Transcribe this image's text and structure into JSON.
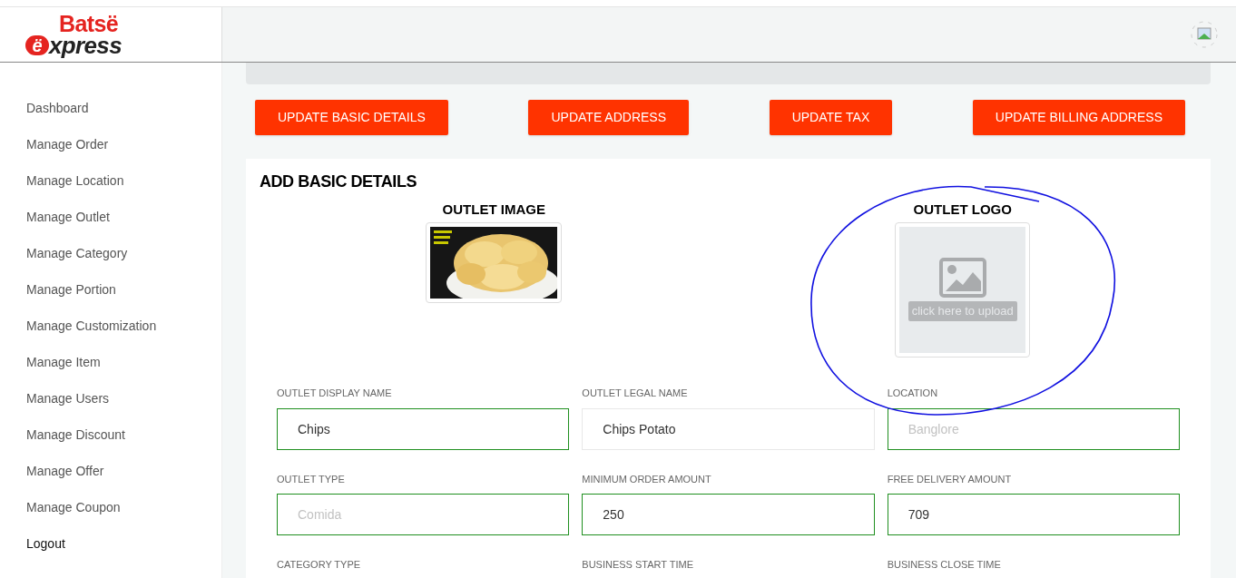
{
  "logo": {
    "top": "Batsë",
    "badge": "ë",
    "bottom": "xpress"
  },
  "sidebar": {
    "items": [
      {
        "label": "Dashboard",
        "selected": false
      },
      {
        "label": "Manage Order",
        "selected": false
      },
      {
        "label": "Manage Location",
        "selected": false
      },
      {
        "label": "Manage Outlet",
        "selected": false
      },
      {
        "label": "Manage Category",
        "selected": false
      },
      {
        "label": "Manage Portion",
        "selected": false
      },
      {
        "label": "Manage Customization",
        "selected": false
      },
      {
        "label": "Manage Item",
        "selected": false
      },
      {
        "label": "Manage Users",
        "selected": false
      },
      {
        "label": "Manage Discount",
        "selected": false
      },
      {
        "label": "Manage Offer",
        "selected": false
      },
      {
        "label": "Manage Coupon",
        "selected": false
      },
      {
        "label": "Logout",
        "selected": true
      }
    ]
  },
  "actions": [
    "UPDATE BASIC DETAILS",
    "UPDATE ADDRESS",
    "UPDATE TAX",
    "UPDATE BILLING ADDRESS"
  ],
  "card": {
    "title": "ADD BASIC DETAILS",
    "images": [
      {
        "label": "OUTLET IMAGE",
        "kind": "picture"
      },
      {
        "label": "OUTLET LOGO",
        "kind": "upload",
        "hint": "click here to upload"
      }
    ],
    "fields": [
      {
        "label": "OUTLET DISPLAY NAME",
        "value": "Chips",
        "valid": true
      },
      {
        "label": "OUTLET LEGAL NAME",
        "value": "Chips Potato",
        "valid": false
      },
      {
        "label": "LOCATION",
        "placeholder": "Banglore",
        "valid": true
      },
      {
        "label": "OUTLET TYPE",
        "placeholder": "Comida",
        "valid": true
      },
      {
        "label": "MINIMUM ORDER AMOUNT",
        "value": "250",
        "valid": true
      },
      {
        "label": "FREE DELIVERY AMOUNT",
        "value": "709",
        "valid": true
      }
    ],
    "more_labels": [
      "CATEGORY TYPE",
      "BUSINESS START TIME",
      "BUSINESS CLOSE TIME"
    ]
  }
}
